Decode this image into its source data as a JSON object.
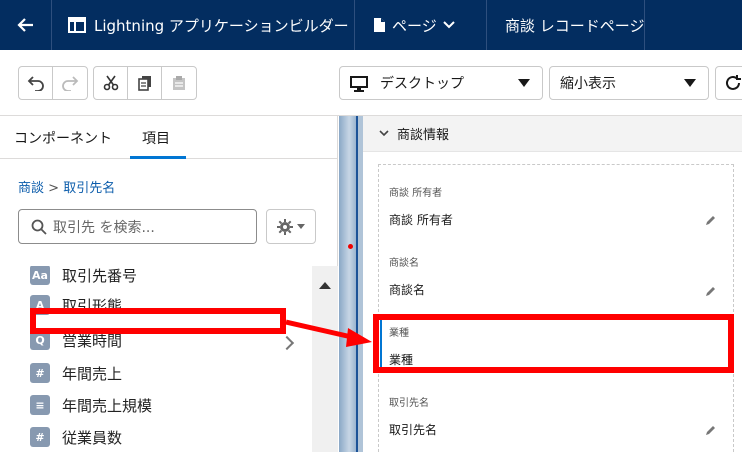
{
  "header": {
    "app_title": "Lightning アプリケーションビルダー",
    "page_menu_label": "ページ",
    "record_page_title": "商談 レコードページ"
  },
  "toolbar": {
    "device_select": "デスクトップ",
    "zoom_select": "縮小表示"
  },
  "left_panel": {
    "tabs": [
      {
        "label": "コンポーネント",
        "active": false
      },
      {
        "label": "項目",
        "active": true
      }
    ],
    "breadcrumb": {
      "root": "商談",
      "separator": ">",
      "current": "取引先名"
    },
    "search": {
      "placeholder": "取引先 を検索..."
    },
    "fields": [
      {
        "label": "取引先番号",
        "icon": "text-field-icon",
        "glyph": "Aa"
      },
      {
        "label": "取引形態",
        "icon": "picklist-field-icon",
        "glyph": "A"
      },
      {
        "label": "営業時間",
        "icon": "lookup-field-icon",
        "glyph": "Q"
      },
      {
        "label": "年間売上",
        "icon": "number-field-icon",
        "glyph": "#"
      },
      {
        "label": "年間売上規模",
        "icon": "picklist-field-icon",
        "glyph": "≡"
      },
      {
        "label": "従業員数",
        "icon": "number-field-icon",
        "glyph": "#"
      }
    ]
  },
  "canvas": {
    "section_title": "商談情報",
    "fields": [
      {
        "label": "商談 所有者",
        "value": "商談 所有者"
      },
      {
        "label": "商談名",
        "value": "商談名"
      },
      {
        "label": "業種",
        "value": "業種"
      },
      {
        "label": "取引先名",
        "value": "取引先名"
      }
    ]
  },
  "colors": {
    "header_bg": "#032d60",
    "accent": "#0176d3",
    "annotation": "#ff0000"
  }
}
